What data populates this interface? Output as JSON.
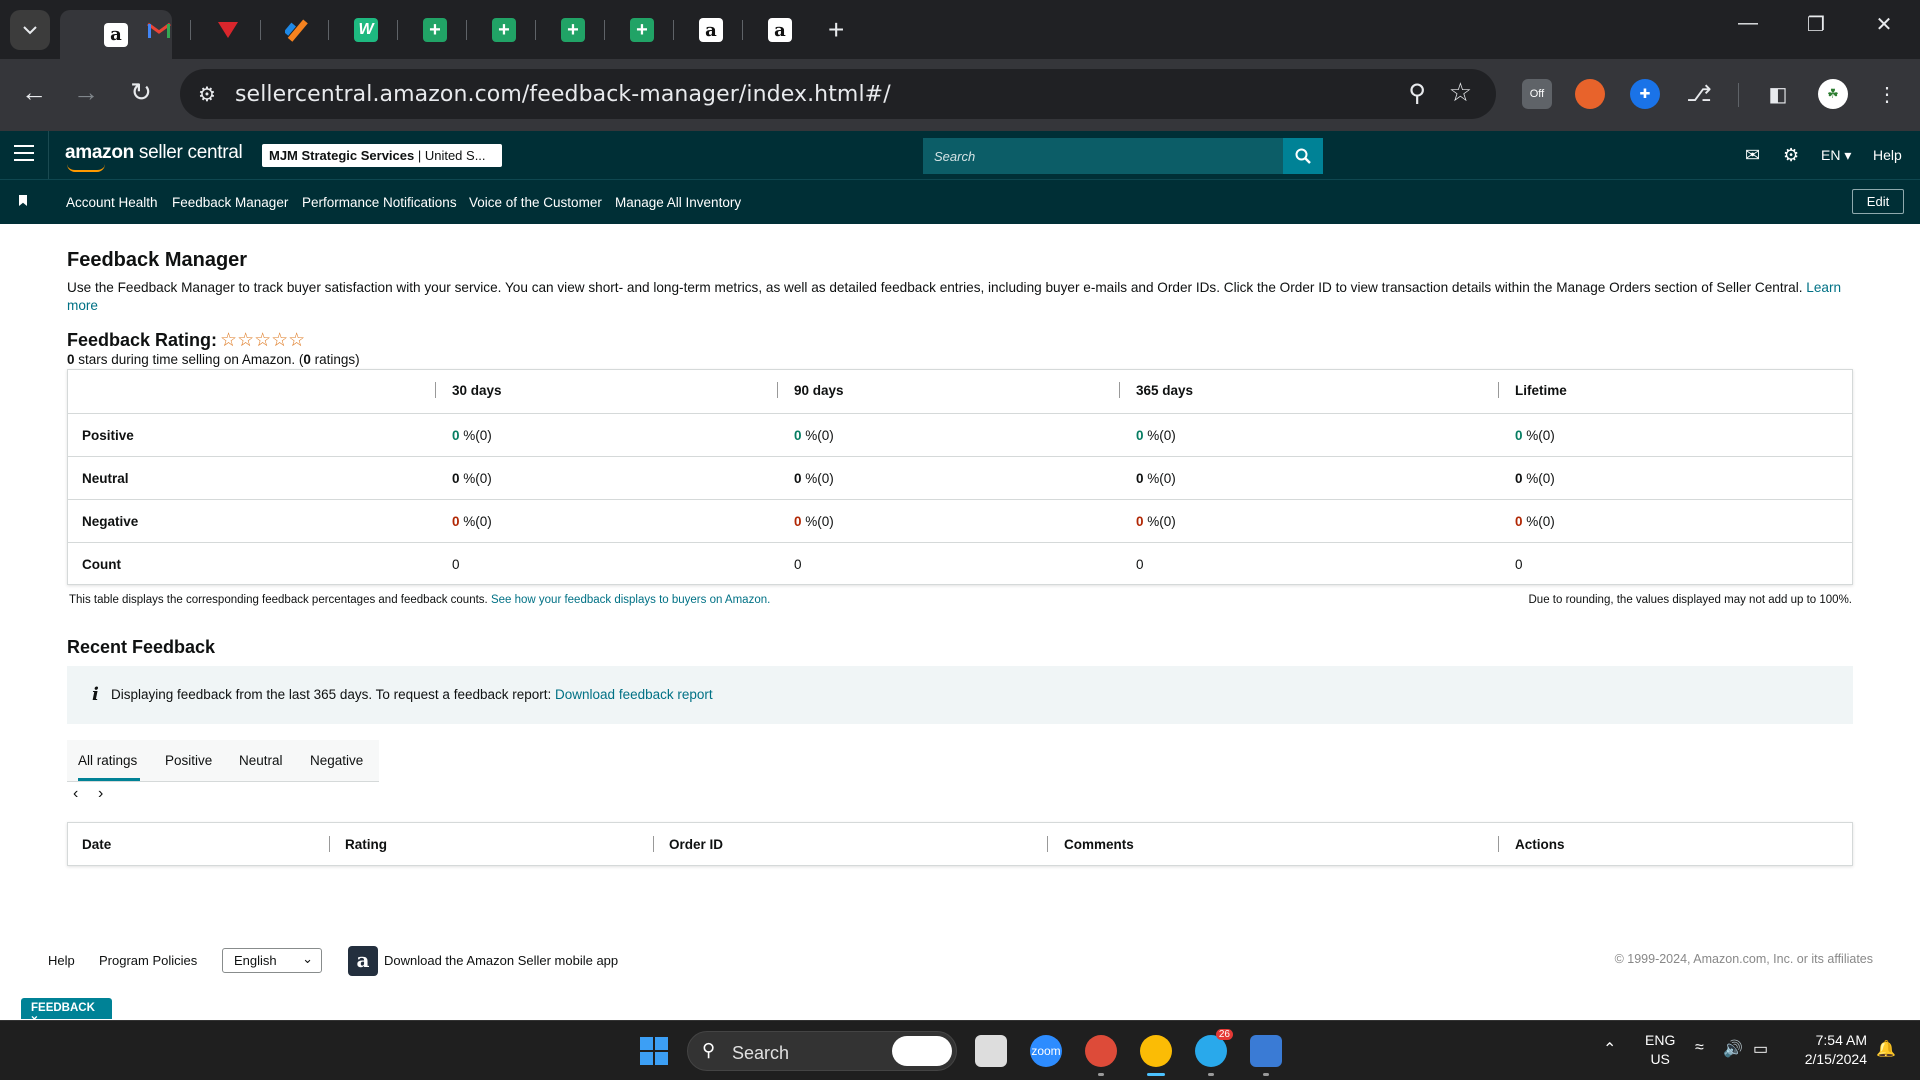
{
  "browser": {
    "url": "sellercentral.amazon.com/feedback-manager/index.html#/",
    "new_tab": "+",
    "tabs": [
      {
        "icon": "amazon-favicon",
        "glyph": "a"
      },
      {
        "icon": "gmail-favicon",
        "glyph": "M"
      },
      {
        "icon": "shopify-favicon",
        "glyph": ""
      },
      {
        "icon": "tool-favicon",
        "glyph": ""
      },
      {
        "icon": "w-favicon",
        "glyph": "W"
      },
      {
        "icon": "sheets-favicon",
        "glyph": "+"
      },
      {
        "icon": "sheets-favicon",
        "glyph": "+"
      },
      {
        "icon": "sheets-favicon",
        "glyph": "+"
      },
      {
        "icon": "sheets-favicon",
        "glyph": "+"
      },
      {
        "icon": "amazon-favicon",
        "glyph": "a"
      },
      {
        "icon": "amazon-favicon",
        "glyph": "a"
      }
    ],
    "extension_badge": "Off"
  },
  "header": {
    "brand_amazon": "amazon",
    "brand_rest": " seller central",
    "store_bold": "MJM Strategic Services",
    "store_rest": " | United S...",
    "search_placeholder": "Search",
    "lang": "EN ▾",
    "help": "Help"
  },
  "nav": {
    "items": [
      "Account Health",
      "Feedback Manager",
      "Performance Notifications",
      "Voice of the Customer",
      "Manage All Inventory"
    ],
    "edit": "Edit"
  },
  "main": {
    "title": "Feedback Manager",
    "intro": "Use the Feedback Manager to track buyer satisfaction with your service. You can view short- and long-term metrics, as well as detailed feedback entries, including buyer e-mails and Order IDs. Click the Order ID to view transaction details within the Manage Orders section of Seller Central.",
    "learn_more": "Learn more",
    "rating_label": "Feedback Rating:",
    "stars": "☆☆☆☆☆",
    "rating_value": "0",
    "rating_mid": " stars during time selling on Amazon. (",
    "rating_count": "0",
    "rating_end": " ratings)"
  },
  "feedback_table": {
    "columns": [
      "30 days",
      "90 days",
      "365 days",
      "Lifetime"
    ],
    "rows": {
      "positive": {
        "label": "Positive",
        "values": [
          "0",
          "0",
          "0",
          "0"
        ],
        "suffix": " %(0)"
      },
      "neutral": {
        "label": "Neutral",
        "values": [
          "0",
          "0",
          "0",
          "0"
        ],
        "suffix": " %(0)"
      },
      "negative": {
        "label": "Negative",
        "values": [
          "0",
          "0",
          "0",
          "0"
        ],
        "suffix": " %(0)"
      },
      "count": {
        "label": "Count",
        "values": [
          "0",
          "0",
          "0",
          "0"
        ]
      }
    },
    "note_left": "This table displays the corresponding feedback percentages and feedback counts.",
    "note_link": "See how your feedback displays to buyers on Amazon.",
    "note_right": "Due to rounding, the values displayed may not add up to 100%."
  },
  "recent": {
    "title": "Recent Feedback",
    "info": "Displaying feedback from the last 365 days. To request a feedback report:",
    "info_link": "Download feedback report",
    "tabs": [
      "All ratings",
      "Positive",
      "Neutral",
      "Negative"
    ],
    "active_tab": "All ratings",
    "columns": [
      "Date",
      "Rating",
      "Order ID",
      "Comments",
      "Actions"
    ]
  },
  "footer": {
    "help": "Help",
    "policies": "Program Policies",
    "language": "English",
    "app_text": "Download the Amazon Seller mobile app",
    "copyright": "© 1999-2024, Amazon.com, Inc. or its affiliates",
    "feedback_tab": "FEEDBACK ×"
  },
  "taskbar": {
    "search": "Search",
    "lang_line1": "ENG",
    "lang_line2": "US",
    "time": "7:54 AM",
    "date": "2/15/2024",
    "telegram_badge": "26"
  },
  "colors": {
    "header_bg": "#002f36",
    "accent": "#008296",
    "positive": "#067d62",
    "negative": "#b12704",
    "link": "#007185",
    "star": "#de7921"
  }
}
